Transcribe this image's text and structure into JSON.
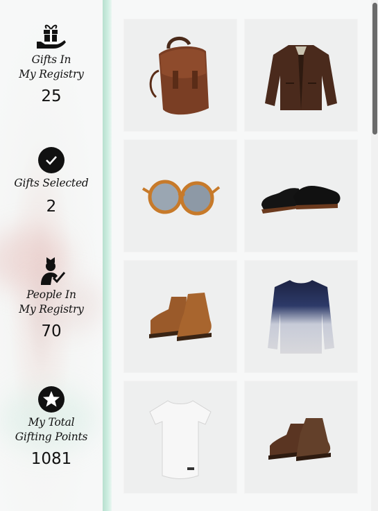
{
  "stats": [
    {
      "label_1": "Gifts In",
      "label_2": "My Registry",
      "value": "25",
      "icon": "gift-in-hand-icon"
    },
    {
      "label_1": "Gifts Selected",
      "label_2": "",
      "value": "2",
      "icon": "check-circle-icon"
    },
    {
      "label_1": "People In",
      "label_2": "My Registry",
      "value": "70",
      "icon": "person-check-icon"
    },
    {
      "label_1": "My Total",
      "label_2": "Gifting Points",
      "value": "1081",
      "icon": "star-circle-icon"
    }
  ],
  "products": [
    {
      "name": "leather-backpack",
      "icon": "backpack-icon"
    },
    {
      "name": "leather-jacket",
      "icon": "jacket-icon"
    },
    {
      "name": "round-sunglasses",
      "icon": "sunglasses-icon"
    },
    {
      "name": "black-derby-shoes",
      "icon": "shoes-icon"
    },
    {
      "name": "brown-lace-up-boots",
      "icon": "boots-icon"
    },
    {
      "name": "ombre-sweater",
      "icon": "sweater-icon"
    },
    {
      "name": "white-t-shirt",
      "icon": "tshirt-icon"
    },
    {
      "name": "brown-chukka-boots",
      "icon": "chukka-boots-icon"
    }
  ],
  "colors": {
    "accent_rail": "#b8e0cf",
    "text": "#111111",
    "tile_bg": "#eeefef"
  }
}
